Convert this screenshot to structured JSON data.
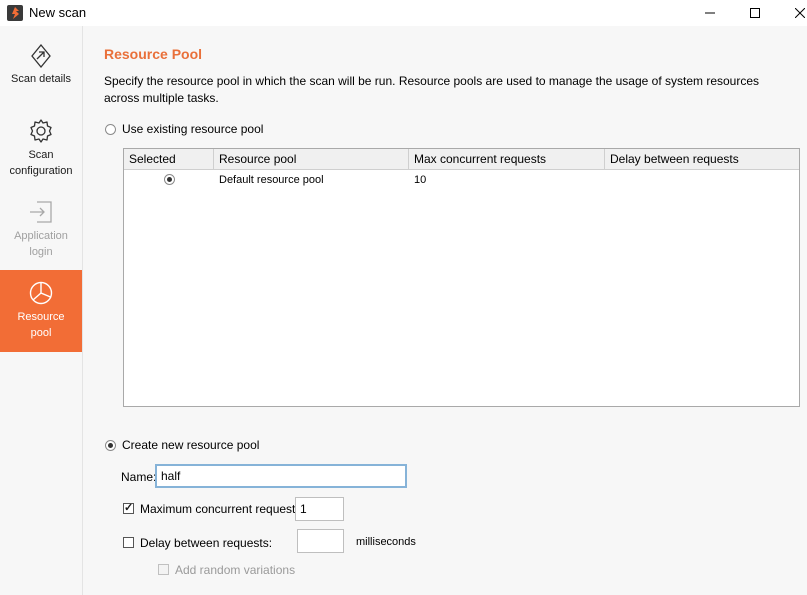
{
  "window": {
    "title": "New scan",
    "minimize_icon": "minimize-icon",
    "maximize_icon": "maximize-icon",
    "close_icon": "close-icon"
  },
  "colors": {
    "accent": "#f26d36",
    "heading": "#e9703a",
    "sidebar_bg": "#f7f7f7"
  },
  "sidebar": {
    "items": [
      {
        "label": "Scan details",
        "icon": "compass-icon",
        "state": "normal"
      },
      {
        "label": "Scan configuration",
        "label_lines": [
          "Scan",
          "configuration"
        ],
        "icon": "gear-icon",
        "state": "normal"
      },
      {
        "label": "Application login",
        "label_lines": [
          "Application",
          "login"
        ],
        "icon": "login-arrow-icon",
        "state": "disabled"
      },
      {
        "label": "Resource pool",
        "label_lines": [
          "Resource",
          "pool"
        ],
        "icon": "pie-chart-icon",
        "state": "active"
      }
    ]
  },
  "main": {
    "heading": "Resource Pool",
    "description": "Specify the resource pool in which the scan will be run. Resource pools are used to manage the usage of system resources across multiple tasks.",
    "existing_option": {
      "label": "Use existing resource pool",
      "selected": false
    },
    "table": {
      "columns": [
        "Selected",
        "Resource pool",
        "Max concurrent requests",
        "Delay between requests"
      ],
      "rows": [
        {
          "selected": true,
          "resource_pool": "Default resource pool",
          "max_concurrent": "10",
          "delay": ""
        }
      ]
    },
    "new_option": {
      "label": "Create new resource pool",
      "selected": true
    },
    "name_label": "Name:",
    "name_value": "half",
    "max_concurrent": {
      "label": "Maximum concurrent requests:",
      "checked": true,
      "value": "1"
    },
    "delay": {
      "label": "Delay between requests:",
      "checked": false,
      "value": "",
      "unit": "milliseconds"
    },
    "random_variations": {
      "label": "Add random variations",
      "checked": false,
      "enabled": false
    }
  }
}
